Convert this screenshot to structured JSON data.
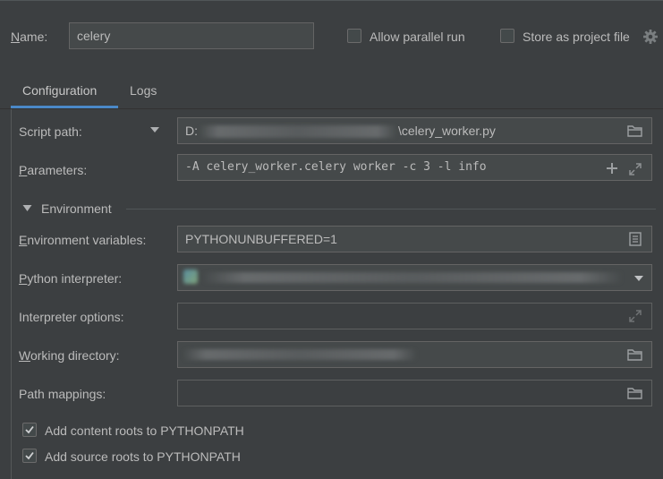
{
  "header": {
    "name_label": "Name:",
    "name_value": "celery",
    "allow_parallel_label": "Allow parallel run",
    "store_project_label": "Store as project file"
  },
  "tabs": [
    {
      "label": "Configuration",
      "active": true
    },
    {
      "label": "Logs",
      "active": false
    }
  ],
  "form": {
    "script_path_label": "Script path:",
    "script_path_prefix": "D:",
    "script_path_suffix": "\\celery_worker.py",
    "parameters_label": "Parameters:",
    "parameters_value": "-A celery_worker.celery worker -c 3 -l info",
    "environment_section": "Environment",
    "env_vars_label": "Environment variables:",
    "env_vars_value": "PYTHONUNBUFFERED=1",
    "interpreter_label": "Python interpreter:",
    "interpreter_options_label": "Interpreter options:",
    "working_dir_label": "Working directory:",
    "path_mappings_label": "Path mappings:",
    "content_roots_label": "Add content roots to PYTHONPATH",
    "source_roots_label": "Add source roots to PYTHONPATH"
  },
  "state": {
    "allow_parallel_checked": false,
    "store_project_checked": false,
    "content_roots_checked": true,
    "source_roots_checked": true
  },
  "colors": {
    "background": "#3c3f41",
    "field_bg": "#45494a",
    "tab_underline": "#4a88c7",
    "text": "#bbbbbb"
  },
  "icons": [
    "gear-icon",
    "dropdown-arrow-icon",
    "folder-icon",
    "plus-icon",
    "expand-icon",
    "document-icon",
    "chevron-down-icon",
    "checkmark-icon"
  ]
}
